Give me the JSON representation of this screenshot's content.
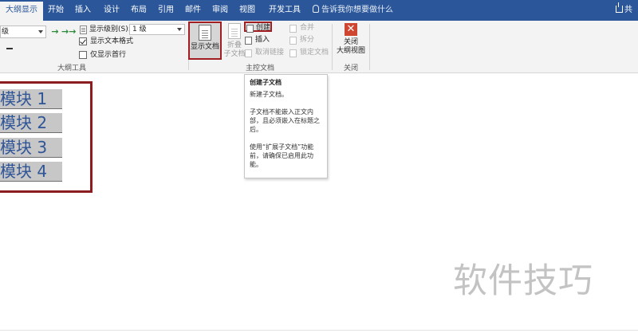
{
  "tabs": [
    {
      "label": "大纲显示",
      "active": true
    },
    {
      "label": "开始",
      "active": false
    },
    {
      "label": "插入",
      "active": false
    },
    {
      "label": "设计",
      "active": false
    },
    {
      "label": "布局",
      "active": false
    },
    {
      "label": "引用",
      "active": false
    },
    {
      "label": "邮件",
      "active": false
    },
    {
      "label": "审阅",
      "active": false
    },
    {
      "label": "视图",
      "active": false
    },
    {
      "label": "开发工具",
      "active": false
    }
  ],
  "tell_me": "告诉我你想要做什么",
  "share_label": "共",
  "outline_tools": {
    "level_value": "级",
    "promote_arrow": "→",
    "promote_all_arrow": "→→",
    "show_level_label": "显示级别(S):",
    "show_level_value": "1 级",
    "show_text_format_label": "显示文本格式",
    "show_text_format_checked": true,
    "show_first_line_label": "仅显示首行",
    "show_first_line_checked": false,
    "group_label": "大纲工具"
  },
  "master_document": {
    "show_document_label": "显示文档",
    "collapse_label_1": "折叠",
    "collapse_label_2": "子文档",
    "create_label": "创建",
    "insert_label": "插入",
    "unlink_label": "取消链接",
    "merge_label": "合并",
    "split_label": "拆分",
    "lock_label": "锁定文档",
    "group_label": "主控文档"
  },
  "close_group": {
    "close_label_1": "关闭",
    "close_label_2": "大纲视图",
    "group_label": "关闭"
  },
  "tooltip": {
    "title": "创建子文档",
    "line1": "新建子文档。",
    "line2": "子文档不能嵌入正文内部，且必须嵌入在标题之后。",
    "line3": "使用“扩展子文档”功能前，请确保已启用此功能。"
  },
  "headings": [
    "模块 1",
    "模块 2",
    "模块 3",
    "模块 4"
  ],
  "watermark": "软件技巧",
  "colors": {
    "tab_bar": "#2b579a",
    "ribbon": "#f3f3f3",
    "highlight_border": "#8b1c20",
    "heading_text": "#2f5597",
    "close_icon": "#cf4630"
  }
}
